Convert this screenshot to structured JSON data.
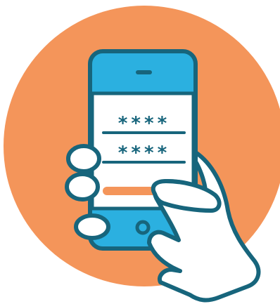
{
  "illustration": {
    "password_field_1": "****",
    "password_field_2": "****"
  },
  "icons": {
    "background": "orange-circle",
    "device": "smartphone-icon",
    "hand": "hand-icon",
    "home_button": "home-button-icon",
    "speaker": "speaker-slot-icon"
  },
  "colors": {
    "circle": "#f4955a",
    "phone_blue": "#2bb0e0",
    "outline": "#17657c",
    "screen": "#ffffff",
    "accent_bar": "#f4955a"
  }
}
